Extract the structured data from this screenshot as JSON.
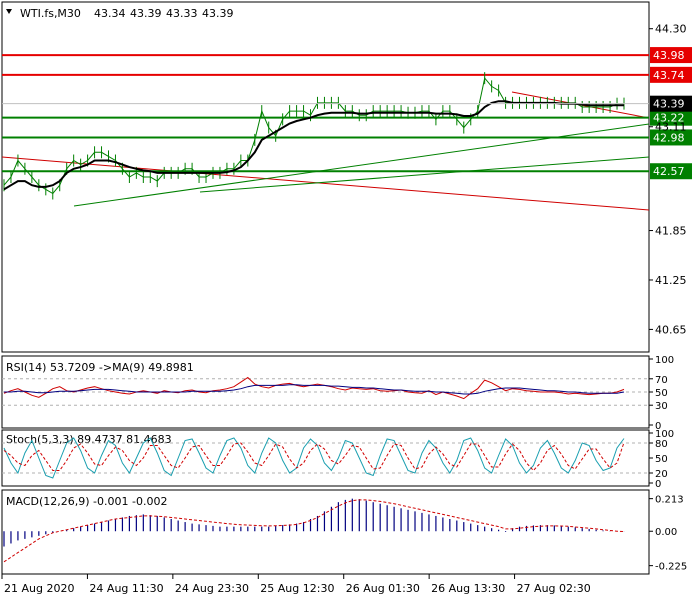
{
  "chart_data": {
    "type": "line",
    "symbol": "WTI.fs,M30",
    "ohlc": [
      "43.34",
      "43.39",
      "43.33",
      "43.39"
    ],
    "price_axis": {
      "ticks": [
        "44.30",
        "43.11",
        "41.85",
        "41.25",
        "40.65"
      ],
      "ylim": [
        40.4,
        44.6
      ]
    },
    "levels": [
      {
        "value": 43.98,
        "label": "43.98",
        "color": "#e60000"
      },
      {
        "value": 43.74,
        "label": "43.74",
        "color": "#e60000"
      },
      {
        "value": 43.22,
        "label": "43.22",
        "color": "#008000"
      },
      {
        "value": 42.98,
        "label": "42.98",
        "color": "#008000"
      },
      {
        "value": 42.57,
        "label": "42.57",
        "color": "#008000"
      }
    ],
    "current_price": {
      "value": 43.39,
      "label": "43.39"
    },
    "x_axis": {
      "labels": [
        "21 Aug 2020",
        "24 Aug 11:30",
        "24 Aug 23:30",
        "25 Aug 12:30",
        "26 Aug 01:30",
        "26 Aug 13:30",
        "27 Aug 02:30"
      ],
      "bars": 125
    },
    "price_series": {
      "name": "",
      "values": [
        42.4,
        42.5,
        42.7,
        42.6,
        42.5,
        42.4,
        42.35,
        42.3,
        42.4,
        42.6,
        42.7,
        42.65,
        42.7,
        42.8,
        42.8,
        42.75,
        42.7,
        42.6,
        42.5,
        42.55,
        42.5,
        42.5,
        42.45,
        42.55,
        42.55,
        42.55,
        42.6,
        42.6,
        42.5,
        42.5,
        42.55,
        42.55,
        42.6,
        42.6,
        42.7,
        42.7,
        42.95,
        43.3,
        43.1,
        43.0,
        43.2,
        43.3,
        43.3,
        43.3,
        43.25,
        43.4,
        43.4,
        43.4,
        43.4,
        43.3,
        43.3,
        43.25,
        43.25,
        43.3,
        43.3,
        43.3,
        43.3,
        43.3,
        43.28,
        43.28,
        43.3,
        43.3,
        43.2,
        43.3,
        43.3,
        43.2,
        43.1,
        43.2,
        43.3,
        43.7,
        43.6,
        43.55,
        43.4,
        43.4,
        43.4,
        43.4,
        43.4,
        43.4,
        43.4,
        43.4,
        43.4,
        43.4,
        43.4,
        43.35,
        43.35,
        43.35,
        43.35,
        43.35,
        43.39,
        43.39
      ]
    },
    "ma_series": {
      "name": "",
      "values": [
        42.35,
        42.4,
        42.45,
        42.45,
        42.4,
        42.38,
        42.38,
        42.4,
        42.45,
        42.55,
        42.6,
        42.62,
        42.65,
        42.7,
        42.7,
        42.7,
        42.68,
        42.65,
        42.62,
        42.6,
        42.58,
        42.57,
        42.55,
        42.55,
        42.55,
        42.55,
        42.55,
        42.55,
        42.55,
        42.55,
        42.55,
        42.55,
        42.56,
        42.58,
        42.62,
        42.7,
        42.8,
        42.95,
        43.0,
        43.05,
        43.1,
        43.15,
        43.18,
        43.2,
        43.22,
        43.25,
        43.27,
        43.28,
        43.28,
        43.28,
        43.28,
        43.27,
        43.27,
        43.28,
        43.28,
        43.28,
        43.28,
        43.28,
        43.28,
        43.28,
        43.28,
        43.28,
        43.27,
        43.27,
        43.27,
        43.26,
        43.24,
        43.24,
        43.27,
        43.35,
        43.4,
        43.42,
        43.42,
        43.4,
        43.4,
        43.4,
        43.4,
        43.4,
        43.4,
        43.4,
        43.39,
        43.39,
        43.39,
        43.38,
        43.37,
        43.37,
        43.37,
        43.37,
        43.37,
        43.37
      ]
    },
    "rsi": {
      "label": "RSI(14) 53.7209  ->MA(9) 49.8981",
      "ticks": [
        "100",
        "70",
        "50",
        "30",
        "0"
      ],
      "values": [
        48,
        52,
        55,
        50,
        45,
        42,
        48,
        55,
        58,
        52,
        50,
        53,
        56,
        58,
        55,
        52,
        50,
        48,
        47,
        50,
        52,
        50,
        48,
        52,
        50,
        49,
        52,
        53,
        50,
        49,
        52,
        53,
        55,
        58,
        65,
        72,
        62,
        58,
        56,
        60,
        62,
        63,
        60,
        58,
        60,
        62,
        60,
        58,
        55,
        53,
        56,
        55,
        54,
        55,
        52,
        51,
        52,
        53,
        50,
        49,
        48,
        52,
        46,
        50,
        47,
        44,
        40,
        48,
        55,
        68,
        64,
        58,
        52,
        55,
        54,
        52,
        51,
        50,
        50,
        50,
        49,
        47,
        48,
        47,
        46,
        47,
        48,
        48,
        50,
        54
      ],
      "ma_values": [
        50,
        50,
        51,
        51,
        50,
        49,
        49,
        50,
        51,
        51,
        51,
        52,
        53,
        54,
        54,
        54,
        53,
        52,
        51,
        50,
        50,
        50,
        50,
        50,
        50,
        50,
        50,
        51,
        51,
        51,
        51,
        51,
        52,
        53,
        55,
        58,
        60,
        60,
        60,
        60,
        60,
        61,
        61,
        60,
        60,
        60,
        60,
        59,
        59,
        58,
        57,
        57,
        56,
        56,
        55,
        54,
        53,
        53,
        52,
        51,
        51,
        51,
        50,
        50,
        49,
        48,
        47,
        47,
        48,
        51,
        53,
        55,
        56,
        56,
        56,
        55,
        54,
        53,
        52,
        52,
        51,
        50,
        50,
        49,
        48,
        48,
        48,
        48,
        48,
        50
      ]
    },
    "stoch": {
      "label": "Stoch(5,3,3) 89.4737 81.4683",
      "ticks": [
        "100",
        "80",
        "50",
        "20",
        "0"
      ],
      "main_values": [
        70,
        40,
        20,
        60,
        85,
        50,
        15,
        10,
        45,
        80,
        90,
        65,
        30,
        20,
        55,
        85,
        75,
        40,
        20,
        50,
        80,
        90,
        60,
        25,
        15,
        50,
        85,
        88,
        60,
        30,
        20,
        55,
        85,
        90,
        70,
        35,
        20,
        60,
        90,
        80,
        45,
        20,
        30,
        70,
        88,
        75,
        40,
        25,
        50,
        85,
        80,
        50,
        20,
        15,
        55,
        88,
        85,
        55,
        25,
        20,
        60,
        85,
        70,
        40,
        20,
        45,
        85,
        90,
        65,
        30,
        20,
        55,
        88,
        75,
        40,
        20,
        35,
        70,
        85,
        60,
        30,
        20,
        45,
        80,
        75,
        45,
        25,
        30,
        70,
        89
      ],
      "signal_values": [
        65,
        55,
        40,
        35,
        55,
        65,
        45,
        25,
        25,
        45,
        70,
        78,
        60,
        38,
        35,
        55,
        72,
        65,
        45,
        35,
        50,
        75,
        75,
        55,
        35,
        30,
        50,
        72,
        75,
        55,
        35,
        35,
        55,
        78,
        80,
        62,
        40,
        35,
        55,
        78,
        72,
        48,
        30,
        40,
        65,
        78,
        68,
        45,
        38,
        55,
        75,
        72,
        50,
        28,
        30,
        55,
        78,
        75,
        50,
        28,
        32,
        58,
        72,
        58,
        38,
        32,
        55,
        78,
        78,
        55,
        32,
        32,
        58,
        78,
        65,
        40,
        25,
        40,
        65,
        75,
        58,
        35,
        28,
        48,
        68,
        68,
        48,
        30,
        40,
        81
      ]
    },
    "macd": {
      "label": "MACD(12,26,9) -0.001 -0.002",
      "ticks": [
        "0.213",
        "0.00",
        "-0.225"
      ],
      "ylim": [
        -0.26,
        0.25
      ],
      "histogram": [
        -0.1,
        -0.08,
        -0.06,
        -0.05,
        -0.04,
        -0.03,
        -0.02,
        -0.01,
        0.0,
        0.01,
        0.02,
        0.03,
        0.04,
        0.05,
        0.06,
        0.07,
        0.08,
        0.09,
        0.1,
        0.105,
        0.11,
        0.105,
        0.1,
        0.09,
        0.08,
        0.07,
        0.06,
        0.05,
        0.045,
        0.04,
        0.035,
        0.03,
        0.03,
        0.03,
        0.03,
        0.03,
        0.03,
        0.03,
        0.03,
        0.035,
        0.04,
        0.045,
        0.05,
        0.06,
        0.08,
        0.1,
        0.13,
        0.16,
        0.19,
        0.205,
        0.213,
        0.21,
        0.2,
        0.19,
        0.18,
        0.17,
        0.16,
        0.15,
        0.14,
        0.13,
        0.12,
        0.11,
        0.1,
        0.09,
        0.08,
        0.07,
        0.06,
        0.05,
        0.04,
        0.03,
        0.02,
        0.01,
        -0.005,
        0.02,
        0.03,
        0.035,
        0.038,
        0.04,
        0.04,
        0.038,
        0.035,
        0.03,
        0.025,
        0.02,
        0.015,
        0.01,
        0.005,
        0.002,
        0.0,
        -0.001
      ],
      "signal": [
        -0.2,
        -0.17,
        -0.14,
        -0.11,
        -0.08,
        -0.05,
        -0.03,
        -0.01,
        0.0,
        0.01,
        0.02,
        0.03,
        0.04,
        0.05,
        0.06,
        0.07,
        0.08,
        0.085,
        0.09,
        0.095,
        0.1,
        0.1,
        0.098,
        0.095,
        0.09,
        0.085,
        0.08,
        0.075,
        0.07,
        0.065,
        0.06,
        0.055,
        0.05,
        0.046,
        0.042,
        0.04,
        0.038,
        0.036,
        0.035,
        0.036,
        0.038,
        0.04,
        0.045,
        0.055,
        0.07,
        0.09,
        0.115,
        0.14,
        0.165,
        0.185,
        0.2,
        0.205,
        0.205,
        0.2,
        0.195,
        0.188,
        0.18,
        0.17,
        0.16,
        0.15,
        0.14,
        0.13,
        0.12,
        0.11,
        0.1,
        0.09,
        0.08,
        0.07,
        0.06,
        0.05,
        0.04,
        0.03,
        0.015,
        0.015,
        0.02,
        0.025,
        0.03,
        0.033,
        0.035,
        0.035,
        0.034,
        0.032,
        0.028,
        0.024,
        0.02,
        0.015,
        0.01,
        0.005,
        0.0,
        -0.002
      ]
    }
  }
}
